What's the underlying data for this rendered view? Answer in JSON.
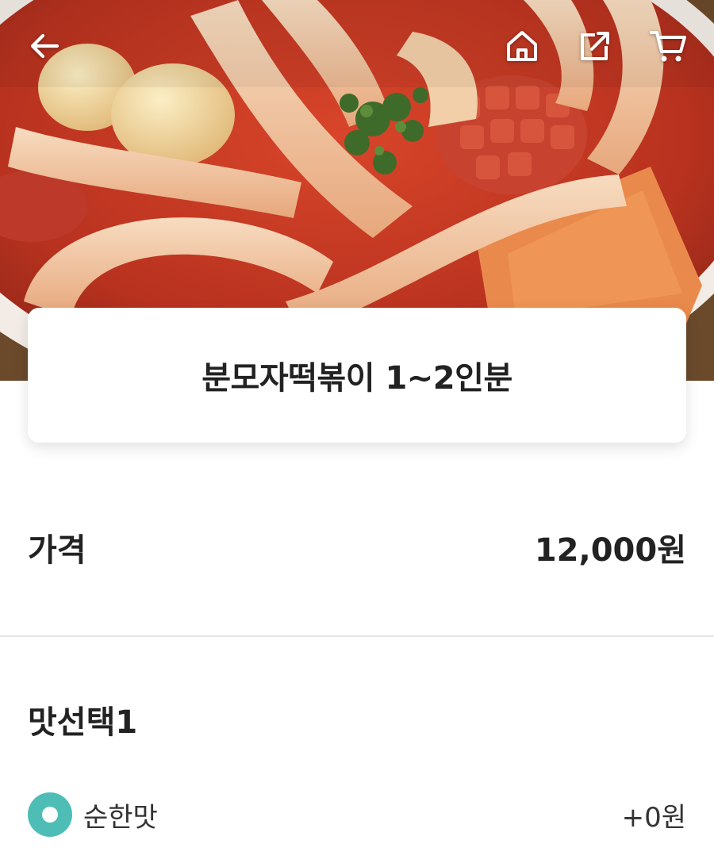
{
  "hero": {
    "icons": [
      "back-arrow-icon",
      "home-icon",
      "share-icon",
      "cart-icon"
    ],
    "icon_color": "#ffffff"
  },
  "product": {
    "title": "분모자떡볶이 1~2인분"
  },
  "price": {
    "label": "가격",
    "value": "12,000원"
  },
  "options": {
    "section_title": "맛선택1",
    "items": [
      {
        "label": "순한맛",
        "price": "+0원",
        "selected": true
      }
    ]
  },
  "colors": {
    "accent": "#4dbdb5",
    "text": "#222222",
    "divider": "#e6e6e6"
  }
}
